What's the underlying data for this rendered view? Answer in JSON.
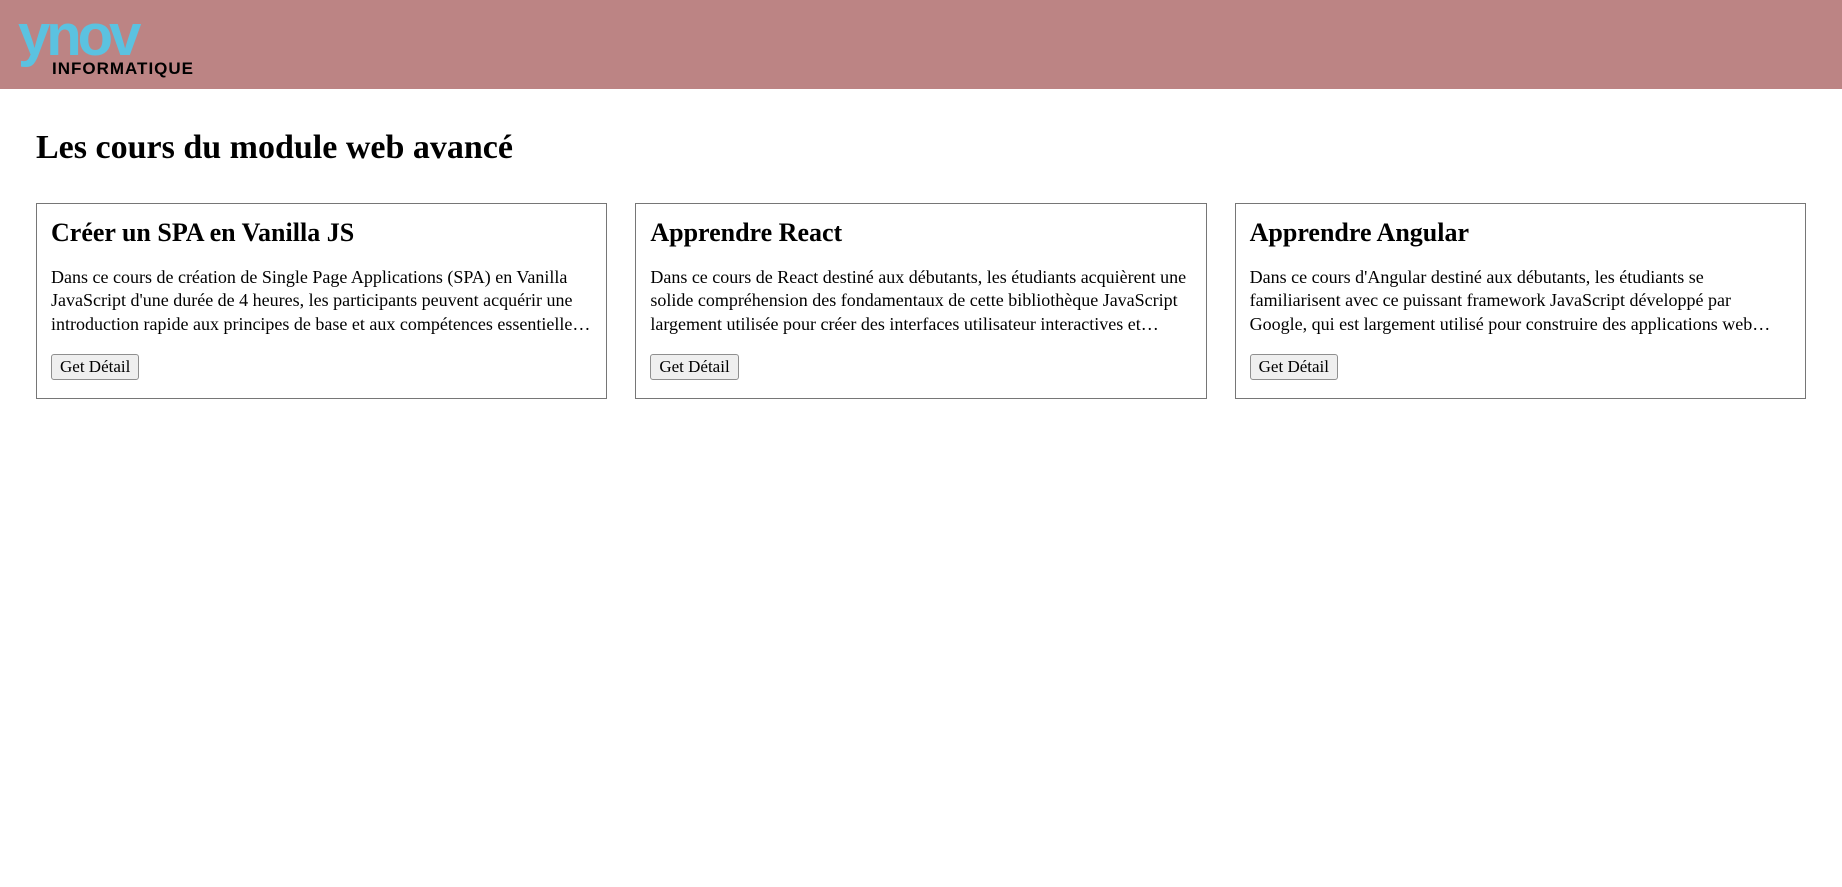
{
  "header": {
    "logo_top": "ynov",
    "logo_sub": "INFORMATIQUE"
  },
  "page": {
    "title": "Les cours du module web avancé"
  },
  "cards": [
    {
      "title": "Créer un SPA en Vanilla JS",
      "description": "Dans ce cours de création de Single Page Applications (SPA) en Vanilla JavaScript d'une durée de 4 heures, les participants peuvent acquérir une introduction rapide aux principes de base et aux compétences essentielles requises pour construire une SPA sans dépendre de frameworks externes.",
      "button_label": "Get Détail"
    },
    {
      "title": "Apprendre React",
      "description": "Dans ce cours de React destiné aux débutants, les étudiants acquièrent une solide compréhension des fondamentaux de cette bibliothèque JavaScript largement utilisée pour créer des interfaces utilisateur interactives et réactives.",
      "button_label": "Get Détail"
    },
    {
      "title": "Apprendre Angular",
      "description": "Dans ce cours d'Angular destiné aux débutants, les étudiants se familiarisent avec ce puissant framework JavaScript développé par Google, qui est largement utilisé pour construire des applications web modernes.",
      "button_label": "Get Détail"
    }
  ]
}
